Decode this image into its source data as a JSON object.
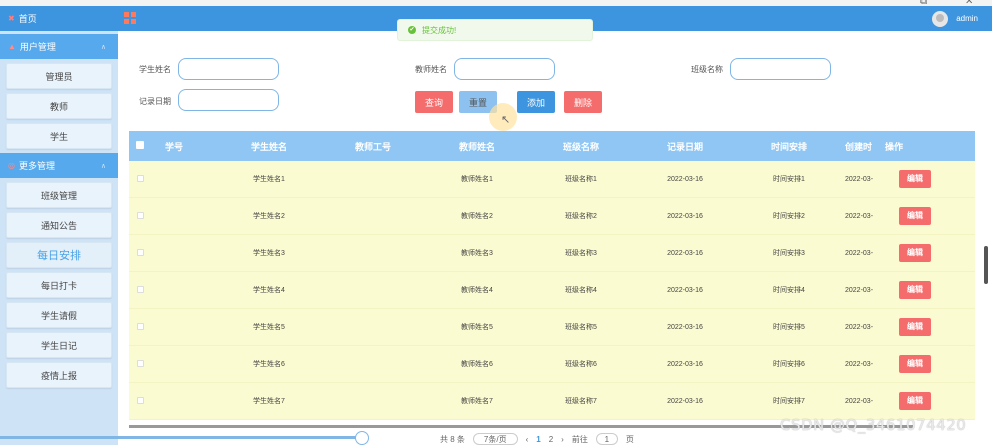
{
  "window": {
    "minimize": "—",
    "restore": "⧉",
    "close": "✕"
  },
  "sidebar": {
    "home": "首页",
    "group1": "用户管理",
    "group1_items": [
      "管理员",
      "教师",
      "学生"
    ],
    "group2": "更多管理",
    "group2_items": [
      "班级管理",
      "通知公告",
      "每日安排",
      "每日打卡",
      "学生请假",
      "学生日记",
      "疫情上报"
    ],
    "active_item": "每日安排"
  },
  "topbar": {
    "username": "admin"
  },
  "toast": {
    "message": "提交成功!"
  },
  "search": {
    "student_name_label": "学生姓名",
    "teacher_name_label": "教师姓名",
    "class_name_label": "班级名称",
    "record_date_label": "记录日期",
    "student_name_value": "",
    "teacher_name_value": "",
    "class_name_value": "",
    "record_date_value": ""
  },
  "buttons": {
    "query": "查询",
    "reset": "重置",
    "add": "添加",
    "delete": "删除"
  },
  "table": {
    "headers": [
      "学号",
      "学生姓名",
      "教师工号",
      "教师姓名",
      "班级名称",
      "记录日期",
      "时间安排",
      "创建时",
      "操作"
    ],
    "rows": [
      {
        "student_no": "",
        "student_name": "学生姓名1",
        "teacher_no": "",
        "teacher_name": "教师姓名1",
        "class_name": "班级名称1",
        "record_date": "2022-03-16",
        "schedule": "时间安排1",
        "created": "2022-03-",
        "action": "编辑"
      },
      {
        "student_no": "",
        "student_name": "学生姓名2",
        "teacher_no": "",
        "teacher_name": "教师姓名2",
        "class_name": "班级名称2",
        "record_date": "2022-03-16",
        "schedule": "时间安排2",
        "created": "2022-03-",
        "action": "编辑"
      },
      {
        "student_no": "",
        "student_name": "学生姓名3",
        "teacher_no": "",
        "teacher_name": "教师姓名3",
        "class_name": "班级名称3",
        "record_date": "2022-03-16",
        "schedule": "时间安排3",
        "created": "2022-03-",
        "action": "编辑"
      },
      {
        "student_no": "",
        "student_name": "学生姓名4",
        "teacher_no": "",
        "teacher_name": "教师姓名4",
        "class_name": "班级名称4",
        "record_date": "2022-03-16",
        "schedule": "时间安排4",
        "created": "2022-03-",
        "action": "编辑"
      },
      {
        "student_no": "",
        "student_name": "学生姓名5",
        "teacher_no": "",
        "teacher_name": "教师姓名5",
        "class_name": "班级名称5",
        "record_date": "2022-03-16",
        "schedule": "时间安排5",
        "created": "2022-03-",
        "action": "编辑"
      },
      {
        "student_no": "",
        "student_name": "学生姓名6",
        "teacher_no": "",
        "teacher_name": "教师姓名6",
        "class_name": "班级名称6",
        "record_date": "2022-03-16",
        "schedule": "时间安排6",
        "created": "2022-03-",
        "action": "编辑"
      },
      {
        "student_no": "",
        "student_name": "学生姓名7",
        "teacher_no": "",
        "teacher_name": "教师姓名7",
        "class_name": "班级名称7",
        "record_date": "2022-03-16",
        "schedule": "时间安排7",
        "created": "2022-03-",
        "action": "编辑"
      }
    ]
  },
  "pagination": {
    "total": "共 8 条",
    "page_size": "7条/页",
    "prev": "‹",
    "page1": "1",
    "page2": "2",
    "next": "›",
    "goto_label": "前往",
    "goto_value": "1",
    "goto_unit": "页"
  },
  "watermark": "CSDN @Q_3461074420",
  "colors": {
    "topbar": "#3d95df",
    "sidebar": "#cfe3f7",
    "table_header": "#8fc6f4",
    "row": "#fbfbd1",
    "danger": "#f56c6c",
    "success": "#67c23a"
  }
}
